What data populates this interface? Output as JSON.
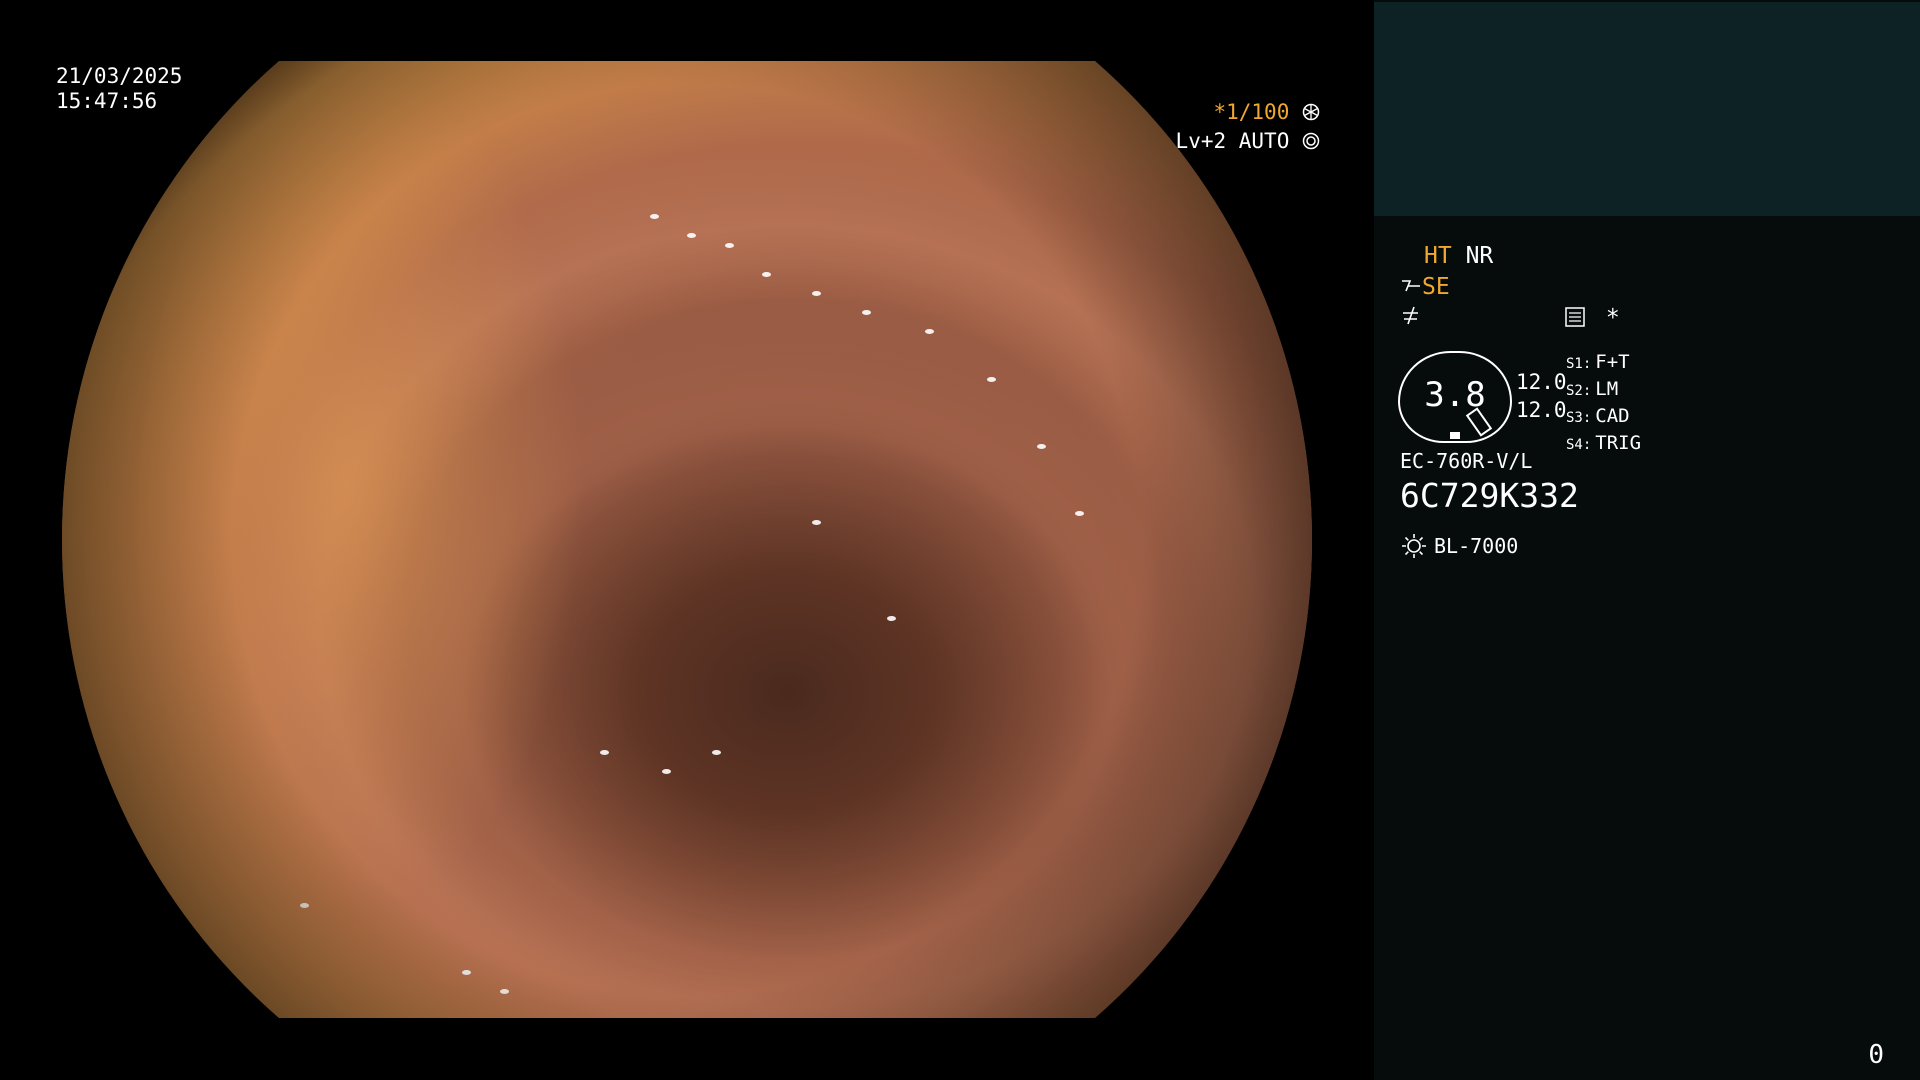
{
  "overlay": {
    "date": "21/03/2025",
    "time": "15:47:56",
    "shutter_prefix": "*",
    "shutter": "1/100",
    "level": "Lv+2 AUTO"
  },
  "panel": {
    "mode_ht": "HT",
    "mode_nr": "NR",
    "mode_se": "SE",
    "star": "*",
    "gauge_value": "3.8",
    "pressure_top": "12.0",
    "pressure_bottom": "12.0",
    "switches": [
      {
        "key": "S1:",
        "value": "F+T"
      },
      {
        "key": "S2:",
        "value": "LM"
      },
      {
        "key": "S3:",
        "value": "CAD"
      },
      {
        "key": "S4:",
        "value": "TRIG"
      }
    ],
    "scope_model": "EC-760R-V/L",
    "serial": "6C729K332",
    "light_source": "BL-7000",
    "counter": "0"
  },
  "colors": {
    "accent_orange": "#f0a830",
    "panel_bg": "#060c0c",
    "preview_bg": "#0c2224"
  },
  "icons": [
    "shutter-dial-icon",
    "auto-iris-icon",
    "zoom-tool-icon",
    "flex-icon",
    "record-menu-icon",
    "light-source-icon"
  ]
}
